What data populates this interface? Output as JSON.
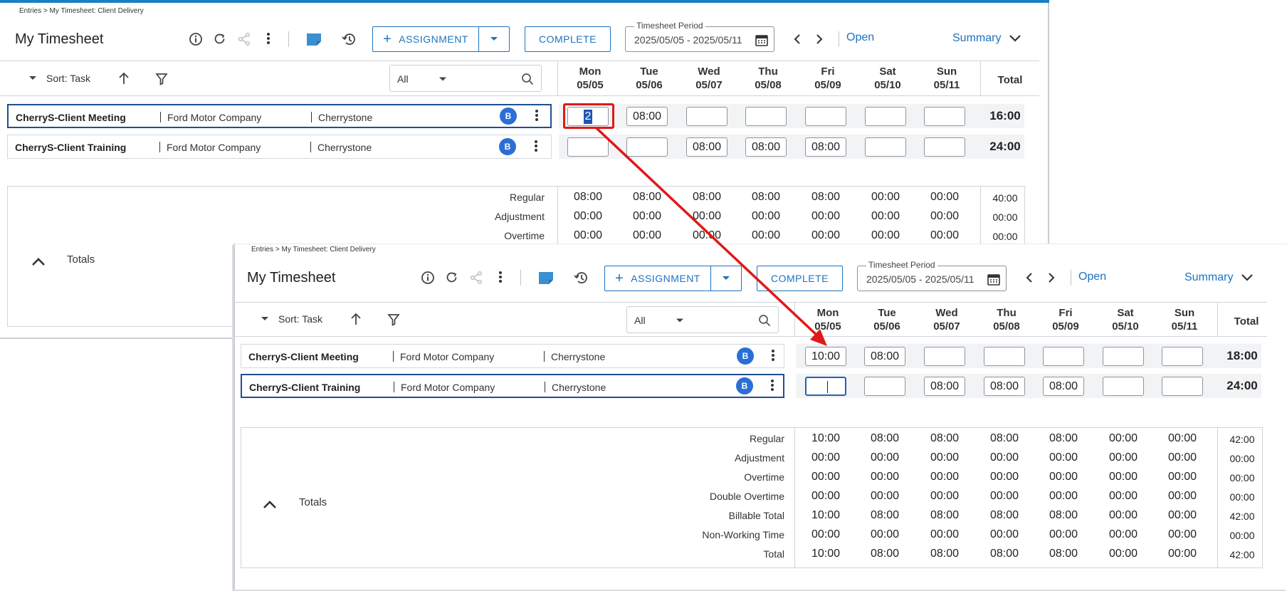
{
  "breadcrumb": "Entries > My Timesheet: Client Delivery",
  "title": "My Timesheet",
  "toolbar": {
    "assignment_label": "ASSIGNMENT",
    "complete_label": "COMPLETE",
    "period_label": "Timesheet Period",
    "period_value": "2025/05/05 - 2025/05/11",
    "open_label": "Open",
    "summary_label": "Summary"
  },
  "grid": {
    "sort_label": "Sort: Task",
    "filter_value": "All",
    "days": [
      {
        "dow": "Mon",
        "date": "05/05"
      },
      {
        "dow": "Tue",
        "date": "05/06"
      },
      {
        "dow": "Wed",
        "date": "05/07"
      },
      {
        "dow": "Thu",
        "date": "05/08"
      },
      {
        "dow": "Fri",
        "date": "05/09"
      },
      {
        "dow": "Sat",
        "date": "05/10"
      },
      {
        "dow": "Sun",
        "date": "05/11"
      }
    ],
    "total_header": "Total"
  },
  "rows": [
    {
      "task": "CherryS-Client Meeting",
      "client": "Ford Motor Company",
      "project": "Cherrystone",
      "badge": "B"
    },
    {
      "task": "CherryS-Client Training",
      "client": "Ford Motor Company",
      "project": "Cherrystone",
      "badge": "B"
    }
  ],
  "before": {
    "row_values": [
      [
        "2",
        "08:00",
        "",
        "",
        "",
        "",
        ""
      ],
      [
        "",
        "",
        "08:00",
        "08:00",
        "08:00",
        "",
        ""
      ]
    ],
    "row_totals": [
      "16:00",
      "24:00"
    ],
    "totals_label": "Totals",
    "totals": [
      {
        "label": "Regular",
        "values": [
          "08:00",
          "08:00",
          "08:00",
          "08:00",
          "08:00",
          "00:00",
          "00:00"
        ],
        "total": "40:00"
      },
      {
        "label": "Adjustment",
        "values": [
          "00:00",
          "00:00",
          "00:00",
          "00:00",
          "00:00",
          "00:00",
          "00:00"
        ],
        "total": "00:00"
      },
      {
        "label": "Overtime",
        "values": [
          "00:00",
          "00:00",
          "00:00",
          "00:00",
          "00:00",
          "00:00",
          "00:00"
        ],
        "total": "00:00"
      }
    ]
  },
  "after": {
    "row_values": [
      [
        "10:00",
        "08:00",
        "",
        "",
        "",
        "",
        ""
      ],
      [
        "",
        "",
        "08:00",
        "08:00",
        "08:00",
        "",
        ""
      ]
    ],
    "row_totals": [
      "18:00",
      "24:00"
    ],
    "totals_label": "Totals",
    "totals": [
      {
        "label": "Regular",
        "values": [
          "10:00",
          "08:00",
          "08:00",
          "08:00",
          "08:00",
          "00:00",
          "00:00"
        ],
        "total": "42:00"
      },
      {
        "label": "Adjustment",
        "values": [
          "00:00",
          "00:00",
          "00:00",
          "00:00",
          "00:00",
          "00:00",
          "00:00"
        ],
        "total": "00:00"
      },
      {
        "label": "Overtime",
        "values": [
          "00:00",
          "00:00",
          "00:00",
          "00:00",
          "00:00",
          "00:00",
          "00:00"
        ],
        "total": "00:00"
      },
      {
        "label": "Double Overtime",
        "values": [
          "00:00",
          "00:00",
          "00:00",
          "00:00",
          "00:00",
          "00:00",
          "00:00"
        ],
        "total": "00:00"
      },
      {
        "label": "Billable Total",
        "values": [
          "10:00",
          "08:00",
          "08:00",
          "08:00",
          "08:00",
          "00:00",
          "00:00"
        ],
        "total": "42:00"
      },
      {
        "label": "Non-Working Time",
        "values": [
          "00:00",
          "00:00",
          "00:00",
          "00:00",
          "00:00",
          "00:00",
          "00:00"
        ],
        "total": "00:00"
      },
      {
        "label": "Total",
        "values": [
          "10:00",
          "08:00",
          "08:00",
          "08:00",
          "08:00",
          "00:00",
          "00:00"
        ],
        "total": "42:00"
      }
    ]
  },
  "colors": {
    "accent": "#1c74c0",
    "badge": "#2a6fd6",
    "annotation": "#e01818",
    "selected_border": "#1f4f91"
  }
}
